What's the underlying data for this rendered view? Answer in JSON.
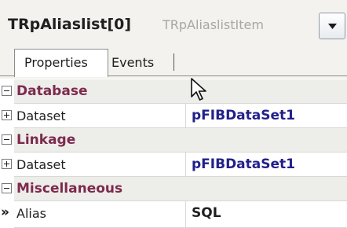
{
  "selector": {
    "object_name": "TRpAliaslist[0]",
    "object_type": "TRpAliaslistItem"
  },
  "tabs": [
    {
      "label": "Properties",
      "active": true
    },
    {
      "label": "Events",
      "active": false
    }
  ],
  "grid": {
    "rows": [
      {
        "kind": "category",
        "label": "Database",
        "expanded": true
      },
      {
        "kind": "property",
        "name": "Dataset",
        "value": "pFIBDataSet1",
        "expandable": true
      },
      {
        "kind": "category",
        "label": "Linkage",
        "expanded": true
      },
      {
        "kind": "property",
        "name": "Dataset",
        "value": "pFIBDataSet1",
        "expandable": true
      },
      {
        "kind": "category",
        "label": "Miscellaneous",
        "expanded": true
      },
      {
        "kind": "property",
        "name": "Alias",
        "value": "SQL",
        "selected": true
      }
    ],
    "selected_marker": "»"
  },
  "colors": {
    "category_text": "#7d2a4e",
    "value_text": "#21208a",
    "category_bg": "#edede9"
  }
}
